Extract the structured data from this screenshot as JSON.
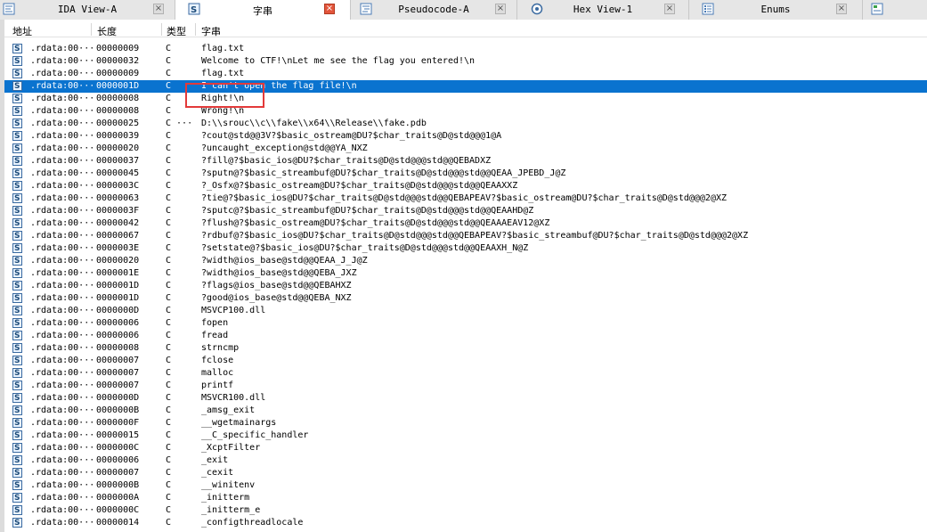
{
  "tabs": [
    {
      "label": "IDA View-A",
      "icon": "ida-view-icon",
      "active": false
    },
    {
      "label": "字串",
      "icon": "strings-icon",
      "active": true
    },
    {
      "label": "Pseudocode-A",
      "icon": "pseudocode-icon",
      "active": false
    },
    {
      "label": "Hex View-1",
      "icon": "hex-view-icon",
      "active": false
    },
    {
      "label": "Enums",
      "icon": "enums-icon",
      "active": false
    },
    {
      "label": "",
      "icon": "structures-icon",
      "active": false
    }
  ],
  "columns": {
    "address": "地址",
    "length": "长度",
    "type": "类型",
    "string": "字串"
  },
  "rows": [
    {
      "address": ".rdata:00···",
      "length": "00000009",
      "type": "C",
      "string": "flag.txt"
    },
    {
      "address": ".rdata:00···",
      "length": "00000032",
      "type": "C",
      "string": "Welcome to CTF!\\nLet me see the flag you entered!\\n"
    },
    {
      "address": ".rdata:00···",
      "length": "00000009",
      "type": "C",
      "string": "flag.txt"
    },
    {
      "address": ".rdata:00···",
      "length": "0000001D",
      "type": "C",
      "string": "I can't open the flag file!\\n",
      "selected": true
    },
    {
      "address": ".rdata:00···",
      "length": "00000008",
      "type": "C",
      "string": "Right!\\n"
    },
    {
      "address": ".rdata:00···",
      "length": "00000008",
      "type": "C",
      "string": "Wrong!\\n"
    },
    {
      "address": ".rdata:00···",
      "length": "00000025",
      "type": "C ···",
      "string": "D:\\\\srouc\\\\c\\\\fake\\\\x64\\\\Release\\\\fake.pdb"
    },
    {
      "address": ".rdata:00···",
      "length": "00000039",
      "type": "C",
      "string": "?cout@std@@3V?$basic_ostream@DU?$char_traits@D@std@@@1@A"
    },
    {
      "address": ".rdata:00···",
      "length": "00000020",
      "type": "C",
      "string": "?uncaught_exception@std@@YA_NXZ"
    },
    {
      "address": ".rdata:00···",
      "length": "00000037",
      "type": "C",
      "string": "?fill@?$basic_ios@DU?$char_traits@D@std@@@std@@QEBADXZ"
    },
    {
      "address": ".rdata:00···",
      "length": "00000045",
      "type": "C",
      "string": "?sputn@?$basic_streambuf@DU?$char_traits@D@std@@@std@@QEAA_JPEBD_J@Z"
    },
    {
      "address": ".rdata:00···",
      "length": "0000003C",
      "type": "C",
      "string": "?_Osfx@?$basic_ostream@DU?$char_traits@D@std@@@std@@QEAAXXZ"
    },
    {
      "address": ".rdata:00···",
      "length": "00000063",
      "type": "C",
      "string": "?tie@?$basic_ios@DU?$char_traits@D@std@@@std@@QEBAPEAV?$basic_ostream@DU?$char_traits@D@std@@@2@XZ"
    },
    {
      "address": ".rdata:00···",
      "length": "0000003F",
      "type": "C",
      "string": "?sputc@?$basic_streambuf@DU?$char_traits@D@std@@@std@@QEAAHD@Z"
    },
    {
      "address": ".rdata:00···",
      "length": "00000042",
      "type": "C",
      "string": "?flush@?$basic_ostream@DU?$char_traits@D@std@@@std@@QEAAAEAV12@XZ"
    },
    {
      "address": ".rdata:00···",
      "length": "00000067",
      "type": "C",
      "string": "?rdbuf@?$basic_ios@DU?$char_traits@D@std@@@std@@QEBAPEAV?$basic_streambuf@DU?$char_traits@D@std@@@2@XZ"
    },
    {
      "address": ".rdata:00···",
      "length": "0000003E",
      "type": "C",
      "string": "?setstate@?$basic_ios@DU?$char_traits@D@std@@@std@@QEAAXH_N@Z"
    },
    {
      "address": ".rdata:00···",
      "length": "00000020",
      "type": "C",
      "string": "?width@ios_base@std@@QEAA_J_J@Z"
    },
    {
      "address": ".rdata:00···",
      "length": "0000001E",
      "type": "C",
      "string": "?width@ios_base@std@@QEBA_JXZ"
    },
    {
      "address": ".rdata:00···",
      "length": "0000001D",
      "type": "C",
      "string": "?flags@ios_base@std@@QEBAHXZ"
    },
    {
      "address": ".rdata:00···",
      "length": "0000001D",
      "type": "C",
      "string": "?good@ios_base@std@@QEBA_NXZ"
    },
    {
      "address": ".rdata:00···",
      "length": "0000000D",
      "type": "C",
      "string": "MSVCP100.dll"
    },
    {
      "address": ".rdata:00···",
      "length": "00000006",
      "type": "C",
      "string": "fopen"
    },
    {
      "address": ".rdata:00···",
      "length": "00000006",
      "type": "C",
      "string": "fread"
    },
    {
      "address": ".rdata:00···",
      "length": "00000008",
      "type": "C",
      "string": "strncmp"
    },
    {
      "address": ".rdata:00···",
      "length": "00000007",
      "type": "C",
      "string": "fclose"
    },
    {
      "address": ".rdata:00···",
      "length": "00000007",
      "type": "C",
      "string": "malloc"
    },
    {
      "address": ".rdata:00···",
      "length": "00000007",
      "type": "C",
      "string": "printf"
    },
    {
      "address": ".rdata:00···",
      "length": "0000000D",
      "type": "C",
      "string": "MSVCR100.dll"
    },
    {
      "address": ".rdata:00···",
      "length": "0000000B",
      "type": "C",
      "string": "_amsg_exit"
    },
    {
      "address": ".rdata:00···",
      "length": "0000000F",
      "type": "C",
      "string": "__wgetmainargs"
    },
    {
      "address": ".rdata:00···",
      "length": "00000015",
      "type": "C",
      "string": "__C_specific_handler"
    },
    {
      "address": ".rdata:00···",
      "length": "0000000C",
      "type": "C",
      "string": "_XcptFilter"
    },
    {
      "address": ".rdata:00···",
      "length": "00000006",
      "type": "C",
      "string": "_exit"
    },
    {
      "address": ".rdata:00···",
      "length": "00000007",
      "type": "C",
      "string": "_cexit"
    },
    {
      "address": ".rdata:00···",
      "length": "0000000B",
      "type": "C",
      "string": "__winitenv"
    },
    {
      "address": ".rdata:00···",
      "length": "0000000A",
      "type": "C",
      "string": "_initterm"
    },
    {
      "address": ".rdata:00···",
      "length": "0000000C",
      "type": "C",
      "string": "_initterm_e"
    },
    {
      "address": ".rdata:00···",
      "length": "00000014",
      "type": "C",
      "string": "_configthreadlocale"
    }
  ],
  "colors": {
    "selection": "#0a73cf",
    "highlight_box": "#e33a3a",
    "active_tab_close": "#e3553b"
  }
}
